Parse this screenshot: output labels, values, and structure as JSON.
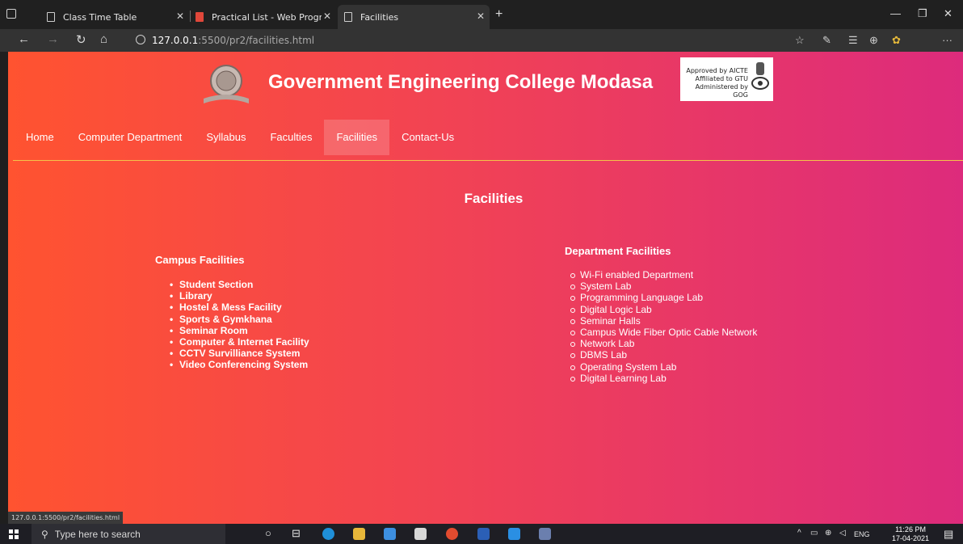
{
  "browser": {
    "tabs": [
      {
        "label": "Class Time Table"
      },
      {
        "label": "Practical List - Web Programming"
      },
      {
        "label": "Facilities"
      }
    ],
    "url_host": "127.0.0.1",
    "url_rest": ":5500/pr2/facilities.html",
    "status_url": "127.0.0.1:5500/pr2/facilities.html"
  },
  "site": {
    "title": "Government Engineering College Modasa",
    "badge_lines": [
      "Approved by AICTE",
      "Affiliated to GTU",
      "Administered by GOG"
    ]
  },
  "nav": [
    {
      "label": "Home",
      "active": false
    },
    {
      "label": "Computer Department",
      "active": false
    },
    {
      "label": "Syllabus",
      "active": false
    },
    {
      "label": "Faculties",
      "active": false
    },
    {
      "label": "Facilities",
      "active": true
    },
    {
      "label": "Contact-Us",
      "active": false
    }
  ],
  "main": {
    "heading": "Facilities",
    "campus": {
      "title": "Campus Facilities",
      "items": [
        "Student Section",
        "Library",
        "Hostel & Mess Facility",
        "Sports & Gymkhana",
        "Seminar Room",
        "Computer & Internet Facility",
        "CCTV Survilliance System",
        "Video Conferencing System"
      ]
    },
    "department": {
      "title": "Department Facilities",
      "items": [
        "Wi-Fi enabled Department",
        "System Lab",
        "Programming Language Lab",
        "Digital Logic Lab",
        "Seminar Halls",
        "Campus Wide Fiber Optic Cable Network",
        "Network Lab",
        "DBMS Lab",
        "Operating System Lab",
        "Digital Learning Lab"
      ]
    }
  },
  "taskbar": {
    "search_placeholder": "Type here to search",
    "lang": "ENG",
    "time": "11:26 PM",
    "date": "17-04-2021"
  },
  "colors": {
    "gradient_start": "#ff5330",
    "gradient_end": "#dd2b7c",
    "nav_divider": "#f4c24a"
  }
}
